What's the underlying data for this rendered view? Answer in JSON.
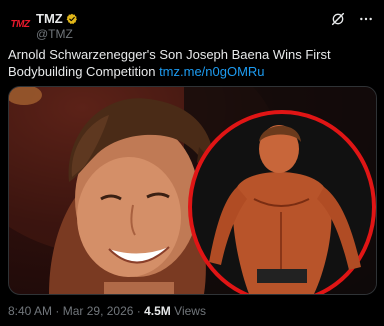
{
  "author": {
    "avatar_text": "TMZ",
    "display_name": "TMZ",
    "handle": "@TMZ"
  },
  "tweet": {
    "text": "Arnold Schwarzenegger's Son Joseph Baena Wins First Bodybuilding Competition",
    "link": "tmz.me/n0gOMRu"
  },
  "media": {
    "description_icon": "photo-collage"
  },
  "meta": {
    "time": "8:40 AM",
    "sep1": "·",
    "date": "Mar 29, 2026",
    "sep2": "·",
    "views_count": "4.5M",
    "views_label": "Views"
  },
  "icons": {
    "verified": "verified-gold-badge-icon",
    "grok": "grok-icon",
    "more": "more-icon"
  },
  "colors": {
    "background": "#000000",
    "text": "#e7e9ea",
    "muted": "#71767b",
    "link": "#1d9bf0",
    "brand_red": "#e8192c",
    "verified_gold": "#e2b719"
  }
}
